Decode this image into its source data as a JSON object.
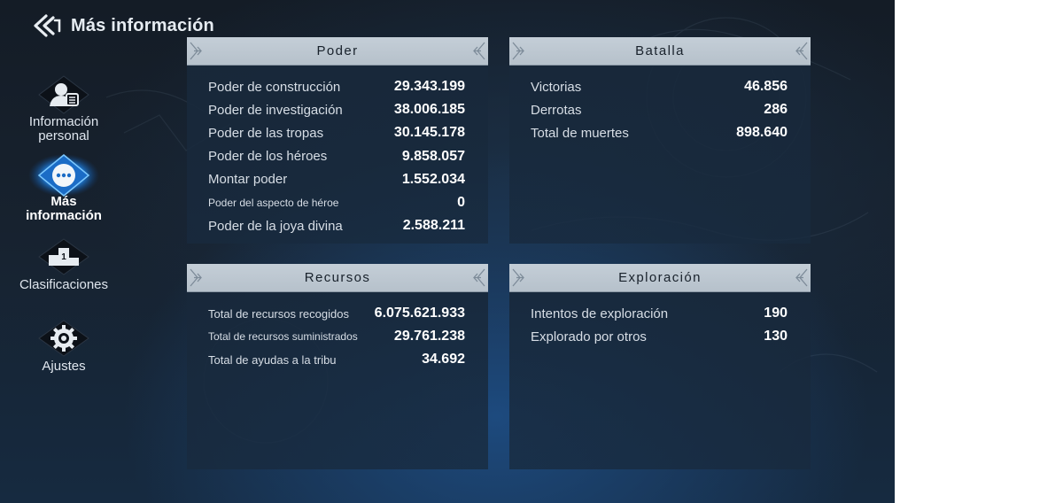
{
  "header": {
    "title": "Más información",
    "back_icon": "back-arrow-icon"
  },
  "sidebar": {
    "items": [
      {
        "label_line1": "Información",
        "label_line2": "personal",
        "icon": "profile-icon",
        "active": false
      },
      {
        "label_line1": "Más",
        "label_line2": "información",
        "icon": "more-info-icon",
        "active": true
      },
      {
        "label_line1": "Clasificaciones",
        "label_line2": "",
        "icon": "podium-icon",
        "active": false
      },
      {
        "label_line1": "Ajustes",
        "label_line2": "",
        "icon": "gear-icon",
        "active": false
      }
    ]
  },
  "panels": {
    "poder": {
      "title": "Poder",
      "rows": [
        {
          "label": "Poder de construcción",
          "value": "29.343.199"
        },
        {
          "label": "Poder de investigación",
          "value": "38.006.185"
        },
        {
          "label": "Poder de las tropas",
          "value": "30.145.178"
        },
        {
          "label": "Poder de los héroes",
          "value": "9.858.057"
        },
        {
          "label": "Montar poder",
          "value": "1.552.034"
        },
        {
          "label": "Poder del aspecto de héroe",
          "value": "0"
        },
        {
          "label": "Poder de la joya divina",
          "value": "2.588.211"
        }
      ]
    },
    "batalla": {
      "title": "Batalla",
      "rows": [
        {
          "label": "Victorias",
          "value": "46.856"
        },
        {
          "label": "Derrotas",
          "value": "286"
        },
        {
          "label": "Total de muertes",
          "value": "898.640"
        }
      ]
    },
    "recursos": {
      "title": "Recursos",
      "rows": [
        {
          "label": "Total de recursos recogidos",
          "value": "6.075.621.933"
        },
        {
          "label": "Total de recursos suministrados",
          "value": "29.761.238"
        },
        {
          "label": "Total de ayudas a la tribu",
          "value": "34.692"
        }
      ]
    },
    "exploracion": {
      "title": "Exploración",
      "rows": [
        {
          "label": "Intentos de exploración",
          "value": "190"
        },
        {
          "label": "Explorado por otros",
          "value": "130"
        }
      ]
    }
  },
  "colors": {
    "accent": "#3aa6ff",
    "panel_header": "#c0cad3",
    "text": "#d7dee6"
  }
}
